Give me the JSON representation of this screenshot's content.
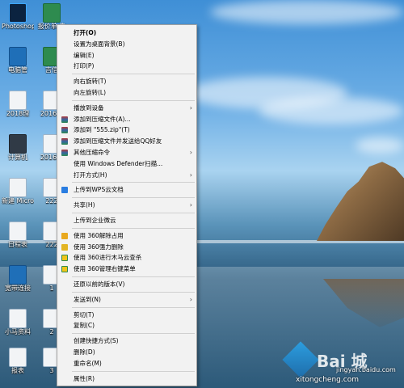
{
  "desktop_icons": [
    {
      "label": "Photoshop",
      "icon": "photoshop-icon"
    },
    {
      "label": "报价单 电",
      "icon": "excel-file-icon"
    },
    {
      "label": "电脑管",
      "icon": "shortcut-icon"
    },
    {
      "label": "吉信",
      "icon": "excel-file-icon"
    },
    {
      "label": "2018理",
      "icon": "doc-file-icon"
    },
    {
      "label": "2016-0",
      "icon": "doc-file-icon"
    },
    {
      "label": "计算机",
      "icon": "computer-icon"
    },
    {
      "label": "2016-0",
      "icon": "doc-file-icon"
    },
    {
      "label": "新建 Microsoft",
      "icon": "doc-file-icon"
    },
    {
      "label": "222",
      "icon": "doc-file-icon"
    },
    {
      "label": "日程表",
      "icon": "doc-file-icon"
    },
    {
      "label": "222",
      "icon": "doc-file-icon"
    },
    {
      "label": "宽带连接",
      "icon": "network-icon"
    },
    {
      "label": "1",
      "icon": "doc-file-icon"
    },
    {
      "label": "小马资料",
      "icon": "doc-file-icon"
    },
    {
      "label": "2",
      "icon": "doc-file-icon"
    },
    {
      "label": "报表",
      "icon": "doc-file-icon"
    },
    {
      "label": "3",
      "icon": "doc-file-icon"
    }
  ],
  "context_menu": {
    "groups": [
      [
        {
          "label": "打开(O)",
          "bold": true
        },
        {
          "label": "设置为桌面背景(B)"
        },
        {
          "label": "编辑(E)"
        },
        {
          "label": "打印(P)"
        }
      ],
      [
        {
          "label": "向右旋转(T)"
        },
        {
          "label": "向左旋转(L)"
        }
      ],
      [
        {
          "label": "播放到设备",
          "submenu": true
        },
        {
          "label": "添加到压缩文件(A)...",
          "icon": "winrar-icon"
        },
        {
          "label": "添加到 \"555.zip\"(T)",
          "icon": "winrar-icon"
        },
        {
          "label": "添加到压缩文件并发送给QQ好友",
          "icon": "winrar-icon"
        },
        {
          "label": "其他压缩命令",
          "icon": "winrar-icon",
          "submenu": true
        },
        {
          "label": "使用 Windows Defender扫描..."
        },
        {
          "label": "打开方式(H)",
          "submenu": true
        }
      ],
      [
        {
          "label": "上传到WPS云文档",
          "icon": "wps-cloud-icon"
        }
      ],
      [
        {
          "label": "共享(H)",
          "submenu": true
        }
      ],
      [
        {
          "label": "上传到企业微云"
        }
      ],
      [
        {
          "label": "使用 360解除占用",
          "icon": "360-unlock-icon"
        },
        {
          "label": "使用 360强力删除",
          "icon": "360-delete-icon"
        },
        {
          "label": "使用 360进行木马云查杀",
          "icon": "360-scan-icon"
        },
        {
          "label": "使用 360管理右键菜单",
          "icon": "360-menu-icon"
        }
      ],
      [
        {
          "label": "还原以前的版本(V)"
        }
      ],
      [
        {
          "label": "发送到(N)",
          "submenu": true
        }
      ],
      [
        {
          "label": "剪切(T)"
        },
        {
          "label": "复制(C)"
        }
      ],
      [
        {
          "label": "创建快捷方式(S)"
        },
        {
          "label": "删除(D)"
        },
        {
          "label": "重命名(M)"
        }
      ],
      [
        {
          "label": "属性(R)"
        }
      ]
    ],
    "submenu_arrow": "›"
  },
  "watermark": {
    "text": "Bai 城",
    "url": "jingyan.baidu.com",
    "url2": "xitongcheng.com"
  },
  "colors": {
    "menu_bg": "#f2f2f2",
    "annotation_arrow": "#e2231a"
  }
}
